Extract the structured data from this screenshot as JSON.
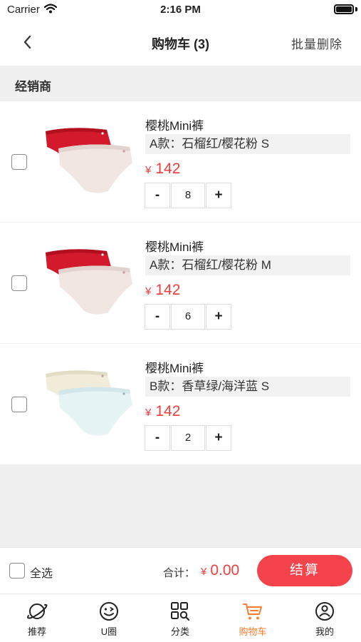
{
  "status_bar": {
    "carrier": "Carrier",
    "time": "2:16 PM"
  },
  "nav": {
    "title": "购物车 (3)",
    "action": "批量删除"
  },
  "dealer": {
    "label": "经销商"
  },
  "items": [
    {
      "name": "樱桃Mini裤",
      "variant": "A款：石榴红/樱花粉 S",
      "currency": "¥",
      "price": "142",
      "quantity": "8",
      "minus": "-",
      "plus": "+",
      "thumb_colors": [
        "#d21a2c",
        "#f1e6e2"
      ]
    },
    {
      "name": "樱桃Mini裤",
      "variant": "A款：石榴红/樱花粉 M",
      "currency": "¥",
      "price": "142",
      "quantity": "6",
      "minus": "-",
      "plus": "+",
      "thumb_colors": [
        "#d21a2c",
        "#f1e6e2"
      ]
    },
    {
      "name": "樱桃Mini裤",
      "variant": "B款：香草绿/海洋蓝 S",
      "currency": "¥",
      "price": "142",
      "quantity": "2",
      "minus": "-",
      "plus": "+",
      "thumb_colors": [
        "#f1ecd9",
        "#e6f4f6"
      ]
    }
  ],
  "checkout": {
    "select_all": "全选",
    "total_label": "合计：",
    "currency": "¥",
    "total": "0.00",
    "button": "结算"
  },
  "tabs": [
    {
      "label": "推荐",
      "icon": "planet-icon",
      "active": false
    },
    {
      "label": "U圈",
      "icon": "wink-face-icon",
      "active": false
    },
    {
      "label": "分类",
      "icon": "grid-search-icon",
      "active": false
    },
    {
      "label": "购物车",
      "icon": "cart-icon",
      "active": true
    },
    {
      "label": "我的",
      "icon": "user-icon",
      "active": false
    }
  ],
  "colors": {
    "accent": "#f5434b",
    "price": "#f23d3d",
    "tab_active": "#ff7b2b"
  }
}
